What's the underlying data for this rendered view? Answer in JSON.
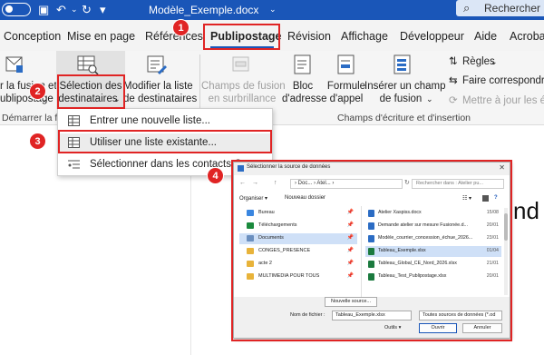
{
  "titlebar": {
    "doc_title": "Modèle_Exemple.docx",
    "caret": "⌄",
    "search_label": "Rechercher"
  },
  "tabs": [
    {
      "label": "Conception"
    },
    {
      "label": "Mise en page"
    },
    {
      "label": "Références"
    },
    {
      "label": "Publipostage"
    },
    {
      "label": "Révision"
    },
    {
      "label": "Affichage"
    },
    {
      "label": "Développeur"
    },
    {
      "label": "Aide"
    },
    {
      "label": "Acroba"
    }
  ],
  "ribbon": {
    "start_merge": {
      "line1": "r la fusion et",
      "line2": "ublipostage",
      "caret": "⌄"
    },
    "select_recipients": {
      "line1": "Sélection des",
      "line2": "destinataires",
      "caret": "⌄"
    },
    "edit_list": {
      "line1": "Modifier la liste",
      "line2": "de destinataires"
    },
    "group_start": "Démarrer la fu",
    "highlight_fields": {
      "line1": "Champs de fusion",
      "line2": "en surbrillance"
    },
    "address_block": {
      "line1": "Bloc",
      "line2": "d'adresse"
    },
    "greeting_line": {
      "line1": "Formule",
      "line2": "d'appel"
    },
    "insert_field": {
      "line1": "Insérer un champ",
      "line2": "de fusion",
      "caret": "⌄"
    },
    "group_write": "Champs d'écriture et d'insertion",
    "rules": {
      "label": "Règles",
      "caret": "⌄"
    },
    "match_fields": "Faire correspondre l",
    "update_labels": "Mettre à jour les étiq"
  },
  "dropdown": {
    "items": [
      {
        "label": "Entrer une nouvelle liste..."
      },
      {
        "label": "Utiliser une liste existante..."
      },
      {
        "label": "Sélectionner dans les contacts Out"
      }
    ]
  },
  "badges": [
    "1",
    "2",
    "3",
    "4"
  ],
  "dialog": {
    "title": "Sélectionner la source de données",
    "close": "✕",
    "nav": {
      "back": "←",
      "forward": "→",
      "up": "↑",
      "refresh": "↻"
    },
    "path": "›  Doc...  ›  Atel...  ›",
    "search_placeholder": "Rechercher dans : Atelier pu...",
    "toolbar": {
      "organize": "Organiser ▾",
      "new_folder": "Nouveau dossier"
    },
    "left_items": [
      {
        "label": "Bureau",
        "pin": "📌"
      },
      {
        "label": "Téléchargements",
        "pin": "📌"
      },
      {
        "label": "Documents",
        "pin": "📌"
      },
      {
        "label": "CONGES_PRESENCE",
        "pin": "📌"
      },
      {
        "label": "acte 2",
        "pin": "📌"
      },
      {
        "label": "MULTIMEDIA POUR TOUS",
        "pin": "📌"
      }
    ],
    "files": [
      {
        "name": "Atelier Xaspiss.docx",
        "date": "15/08"
      },
      {
        "name": "Demande atelier sur mesure Fusionée.d...",
        "date": "20/01"
      },
      {
        "name": "Modèle_courrier_concession_échue_2026...",
        "date": "23/01"
      },
      {
        "name": "Tableau_Exemple.xlsx",
        "date": "01/04"
      },
      {
        "name": "Tableau_Global_CE_Nord_2026.xlsx",
        "date": "21/01"
      },
      {
        "name": "Tableau_Test_Publipostage.xlsx",
        "date": "20/01"
      }
    ],
    "new_source_button": "Nouvelle source...",
    "filename_label": "Nom de fichier :",
    "filename_value": "Tableau_Exemple.xlsx",
    "filetype_value": "Toutes sources de données (*.od",
    "tools": "Outils ▾",
    "open_button": "Ouvrir",
    "cancel_button": "Annuler"
  },
  "background_text": "nd"
}
